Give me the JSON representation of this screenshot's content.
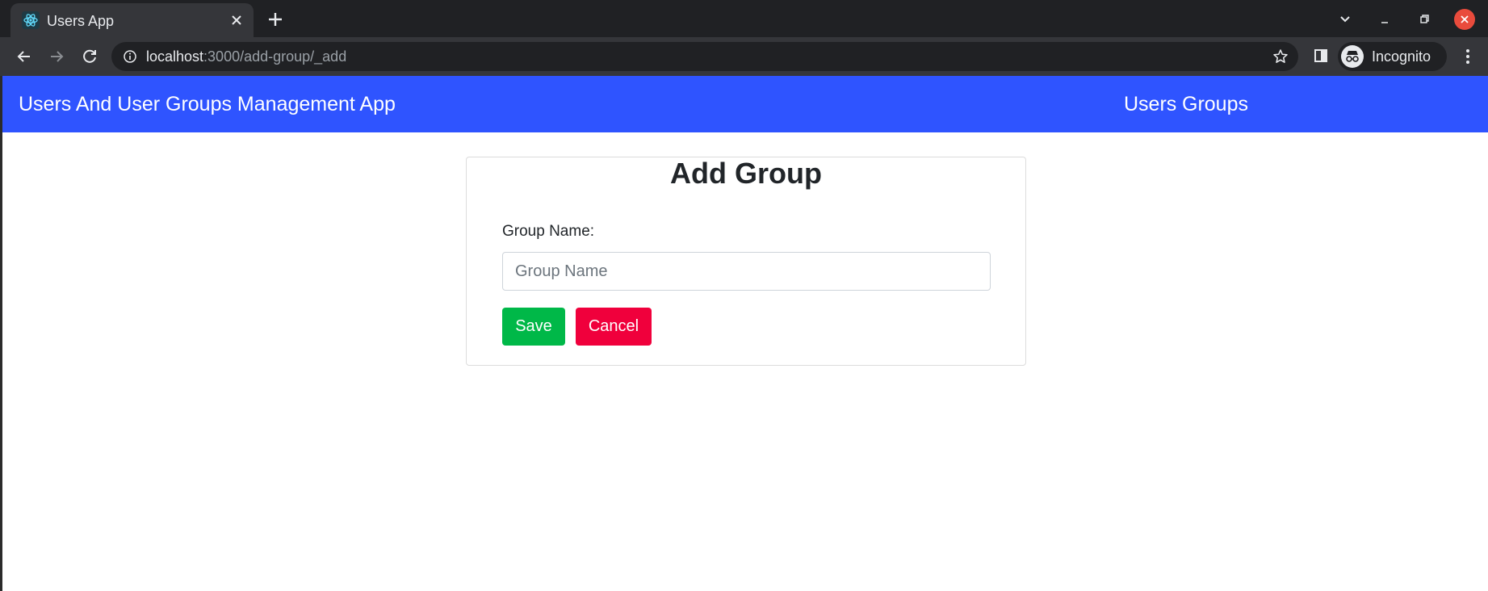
{
  "browser": {
    "tab_title": "Users App",
    "url_host": "localhost",
    "url_path": ":3000/add-group/_add",
    "profile_label": "Incognito",
    "icons": {
      "favicon": "react-logo-icon",
      "tab_close": "close-icon",
      "new_tab": "plus-icon",
      "tab_search": "chevron-down-icon",
      "minimize": "minimize-icon",
      "restore": "restore-icon",
      "close_window": "close-icon",
      "back": "arrow-left-icon",
      "forward": "arrow-right-icon",
      "reload": "reload-icon",
      "site_info": "info-icon",
      "bookmark": "star-icon",
      "side_panel": "side-panel-icon",
      "incognito": "incognito-icon",
      "menu": "kebab-menu-icon"
    }
  },
  "navbar": {
    "brand": "Users And User Groups Management App",
    "links": [
      {
        "label": "Users"
      },
      {
        "label": "Groups"
      }
    ]
  },
  "form": {
    "title": "Add Group",
    "group_name_label": "Group Name:",
    "group_name_placeholder": "Group Name",
    "group_name_value": "",
    "save_label": "Save",
    "cancel_label": "Cancel"
  },
  "colors": {
    "navbar_bg": "#2f54ff",
    "save_bg": "#00b848",
    "cancel_bg": "#f0003c",
    "window_close": "#e94b3c"
  }
}
